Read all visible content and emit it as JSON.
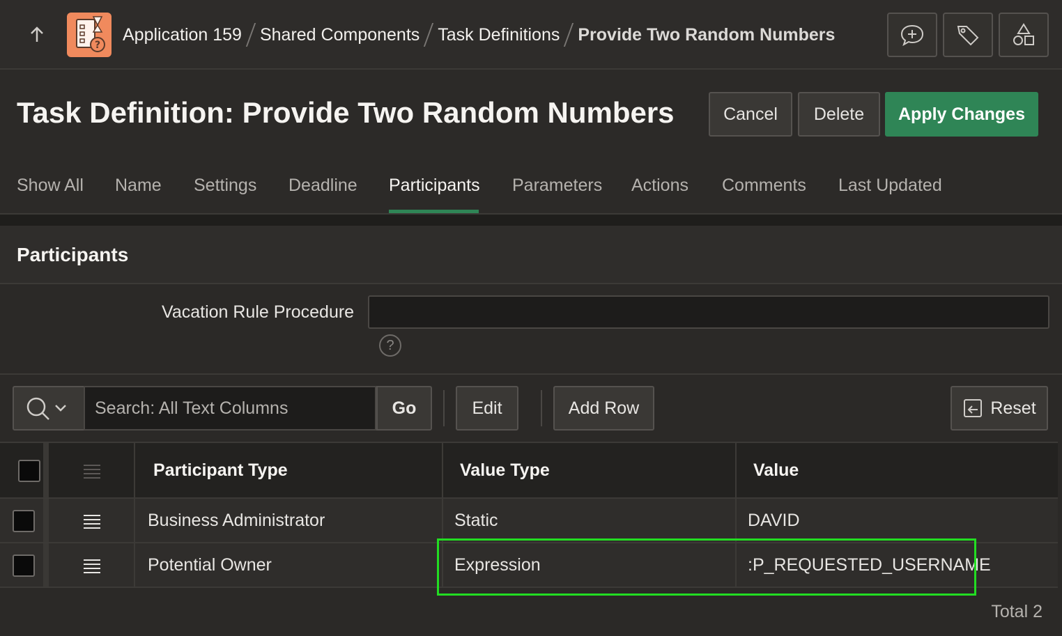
{
  "breadcrumb": {
    "items": [
      "Application 159",
      "Shared Components",
      "Task Definitions"
    ],
    "current": "Provide Two Random Numbers"
  },
  "page": {
    "title": "Task Definition: Provide Two Random Numbers",
    "cancel_label": "Cancel",
    "delete_label": "Delete",
    "apply_label": "Apply Changes"
  },
  "tabs": [
    "Show All",
    "Name",
    "Settings",
    "Deadline",
    "Participants",
    "Parameters",
    "Actions",
    "Comments",
    "Last Updated"
  ],
  "active_tab": "Participants",
  "region": {
    "title": "Participants",
    "vacation_label": "Vacation Rule Procedure",
    "vacation_value": "",
    "help_glyph": "?"
  },
  "toolbar": {
    "search_placeholder": "Search: All Text Columns",
    "go_label": "Go",
    "edit_label": "Edit",
    "add_row_label": "Add Row",
    "reset_label": "Reset"
  },
  "grid": {
    "columns": [
      "Participant Type",
      "Value Type",
      "Value"
    ],
    "rows": [
      {
        "participant_type": "Business Administrator",
        "value_type": "Static",
        "value": "DAVID"
      },
      {
        "participant_type": "Potential Owner",
        "value_type": "Expression",
        "value": ":P_REQUESTED_USERNAME"
      }
    ],
    "total_label": "Total 2"
  },
  "colors": {
    "accent": "#2f8556",
    "highlight": "#22dd22",
    "app_icon": "#f08a5d"
  }
}
